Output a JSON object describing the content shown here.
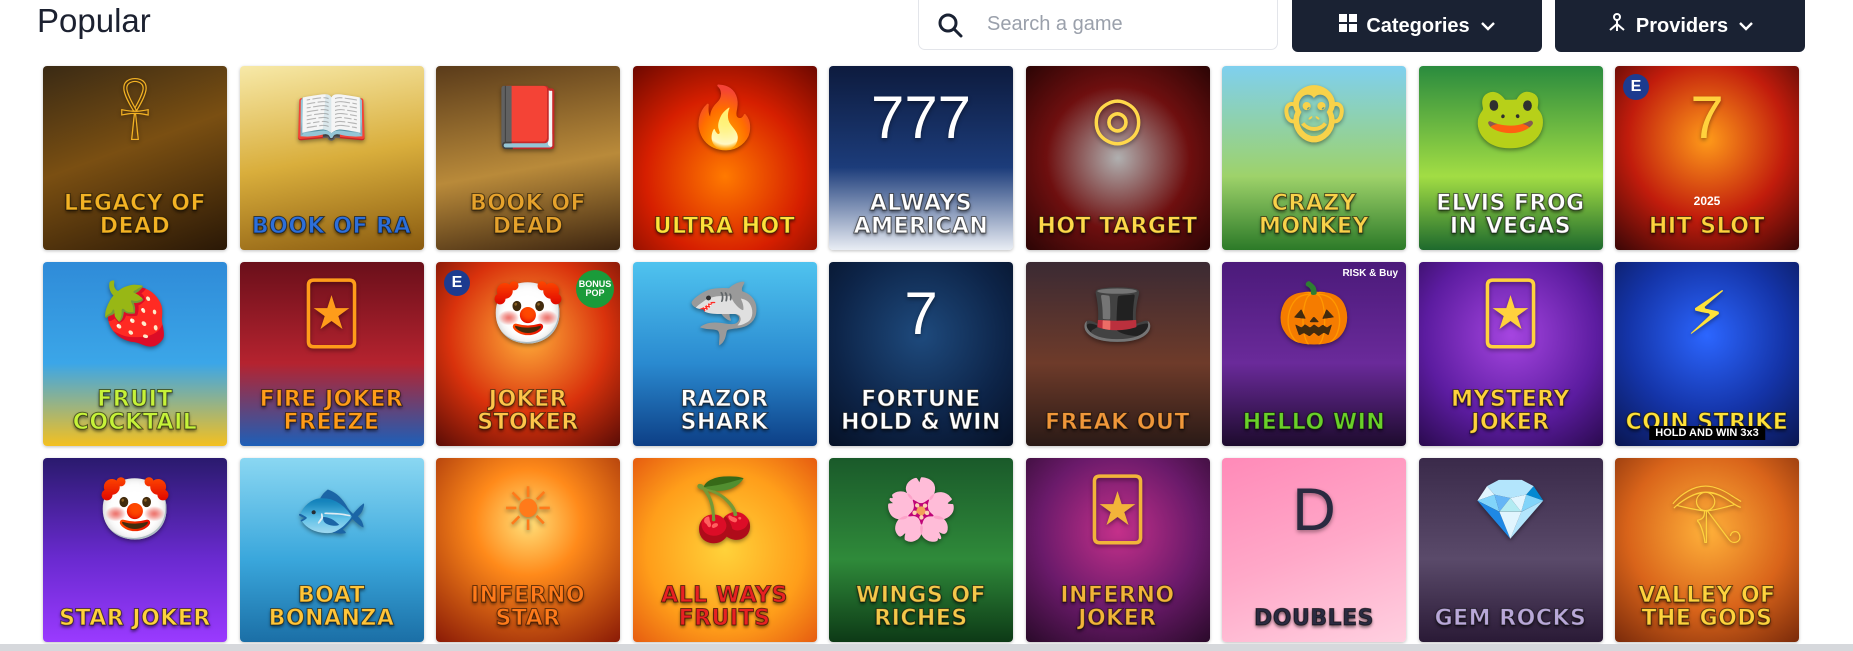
{
  "header": {
    "title": "Popular",
    "search_placeholder": "Search a game",
    "search_icon": "search-icon",
    "categories_label": "Categories",
    "categories_icon": "grid-icon",
    "providers_label": "Providers",
    "providers_icon": "network-icon"
  },
  "games": [
    {
      "name": "Legacy of Dead",
      "bg": "linear-gradient(160deg,#3a2a14 0%,#7a4f12 45%,#2a1806 100%)",
      "fg": "#f4b324",
      "deco": "𓋹"
    },
    {
      "name": "Book of Ra",
      "bg": "linear-gradient(170deg,#f7e9a8 0%,#d9ae3c 50%,#8a5b10 100%)",
      "fg": "#2e6fd8",
      "deco": "📖"
    },
    {
      "name": "Book of Dead",
      "bg": "linear-gradient(170deg,#5a3b1a 0%,#b98a3a 55%,#3d2510 100%)",
      "fg": "#e6a22c",
      "deco": "📕"
    },
    {
      "name": "Ultra Hot",
      "bg": "radial-gradient(circle at 50% 60%,#ff7a00 0%,#d61f00 55%,#6d0800 100%)",
      "fg": "#ffe23a",
      "deco": "🔥"
    },
    {
      "name": "Always American",
      "bg": "linear-gradient(180deg,#0d1b3e 0%,#1c3c7a 55%,#e9edf4 100%)",
      "fg": "#ffffff",
      "deco": "777"
    },
    {
      "name": "Hot Target",
      "bg": "radial-gradient(circle at 50% 50%,#b0b0b0 0%,#6e0f0f 55%,#2b0505 100%)",
      "fg": "#ffd84a",
      "deco": "◎"
    },
    {
      "name": "Crazy Monkey",
      "bg": "linear-gradient(180deg,#7fd0ef 0%,#9ed26a 60%,#2c7a28 100%)",
      "fg": "#f8d24a",
      "deco": "🐵"
    },
    {
      "name": "Elvis Frog in Vegas",
      "bg": "linear-gradient(180deg,#2a8b3e 0%,#a2dd44 60%,#1e6a2d 100%)",
      "fg": "#ffffff",
      "deco": "🐸"
    },
    {
      "name": "Hit Slot",
      "bg": "radial-gradient(circle at 50% 40%,#ff9b1a 0%,#c11c0c 55%,#3a0606 100%)",
      "fg": "#ffd23d",
      "deco": "7"
    },
    {
      "name": "Fruit Cocktail",
      "bg": "linear-gradient(180deg,#2f8bd8 0%,#3ba6e8 55%,#f4c020 100%)",
      "fg": "#c6f23a",
      "deco": "🍓"
    },
    {
      "name": "Fire Joker Freeze",
      "bg": "linear-gradient(180deg,#6a0f1a 0%,#b5232f 55%,#1d5fb8 100%)",
      "fg": "#ff9c1a",
      "deco": "🃏"
    },
    {
      "name": "Joker Stoker",
      "bg": "radial-gradient(circle at 50% 40%,#ffae3a 0%,#d9320c 55%,#5a0c06 100%)",
      "fg": "#ffc54a",
      "deco": "🤡"
    },
    {
      "name": "Razor Shark",
      "bg": "linear-gradient(180deg,#4fc3ef 0%,#2a8ad0 55%,#0d3f86 100%)",
      "fg": "#ffffff",
      "deco": "🦈"
    },
    {
      "name": "Fortune Hold & Win",
      "bg": "radial-gradient(circle at 50% 40%,#1e4a7d 0%,#0d2448 60%,#061126 100%)",
      "fg": "#ffffff",
      "deco": "7"
    },
    {
      "name": "Freak Out",
      "bg": "linear-gradient(180deg,#3b2a33 0%,#6e3b2a 55%,#2a1a16 100%)",
      "fg": "#f0973a",
      "deco": "🎩"
    },
    {
      "name": "Hello Win",
      "bg": "linear-gradient(180deg,#4b1a7a 0%,#6a2a9a 55%,#1d0b2d 100%)",
      "fg": "#6ad02a",
      "deco": "🎃"
    },
    {
      "name": "Mystery Joker",
      "bg": "radial-gradient(circle at 50% 40%,#a545e0 0%,#5c1ca0 60%,#2a0a4e 100%)",
      "fg": "#ffd23d",
      "deco": "🃏"
    },
    {
      "name": "Coin Strike",
      "bg": "radial-gradient(circle at 50% 40%,#2c66ff 0%,#1434a8 55%,#0a1650 100%)",
      "fg": "#ffe23a",
      "deco": "⚡"
    },
    {
      "name": "Star Joker",
      "bg": "linear-gradient(180deg,#2a1a6e 0%,#6a2ad0 55%,#9a3aff 100%)",
      "fg": "#ffd23d",
      "deco": "🤡"
    },
    {
      "name": "Boat Bonanza",
      "bg": "linear-gradient(180deg,#8ad7f2 0%,#3aa7dc 55%,#1b6fa6 100%)",
      "fg": "#ffc53a",
      "deco": "🐟"
    },
    {
      "name": "Inferno Star",
      "bg": "radial-gradient(circle at 50% 35%,#ffe07a 0%,#ff8a1a 35%,#8a1a06 100%)",
      "fg": "#ff7a1a",
      "deco": "☀"
    },
    {
      "name": "All Ways Fruits",
      "bg": "radial-gradient(circle at 50% 50%,#ffd23a 0%,#ff9e1a 60%,#e65c10 100%)",
      "fg": "#e82222",
      "deco": "🍒"
    },
    {
      "name": "Wings of Riches",
      "bg": "linear-gradient(180deg,#1a5a2a 0%,#2f8a3a 55%,#0d3a16 100%)",
      "fg": "#f4c84a",
      "deco": "🌸"
    },
    {
      "name": "Inferno Joker",
      "bg": "radial-gradient(circle at 50% 40%,#c4308a 0%,#6a1a6a 55%,#2a0a2a 100%)",
      "fg": "#f2b43a",
      "deco": "🃏"
    },
    {
      "name": "Doubles",
      "bg": "linear-gradient(160deg,#ff8ab8 0%,#ffa8c8 50%,#ffd0e0 100%)",
      "fg": "#2a2a40",
      "deco": "D"
    },
    {
      "name": "Gem Rocks",
      "bg": "linear-gradient(180deg,#3a2a4a 0%,#5a4a6a 55%,#2a1a36 100%)",
      "fg": "#b9a8d8",
      "deco": "💎"
    },
    {
      "name": "Valley of the Gods",
      "bg": "radial-gradient(circle at 50% 40%,#ffb13a 0%,#d9641a 55%,#7a2a0a 100%)",
      "fg": "#ffd23d",
      "deco": "𓂀"
    }
  ],
  "badges": {
    "provider_e": "E",
    "bonus_pop": "BONUS POP",
    "risk_buy": "RISK & Buy",
    "year": "2025",
    "hold_win": "HOLD AND WIN 3x3"
  }
}
